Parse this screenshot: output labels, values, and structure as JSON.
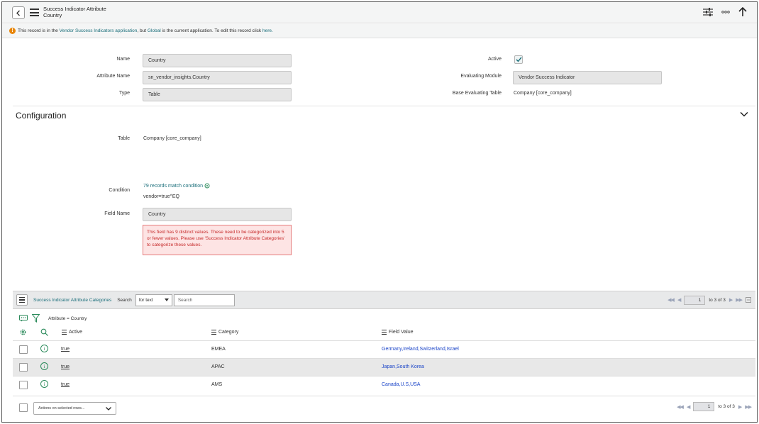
{
  "header": {
    "title": "Success Indicator Attribute",
    "subtitle": "Country"
  },
  "banner": {
    "prefix": "This record is in the",
    "app_link": "Vendor Success Indicators application",
    "middle": ", but",
    "global_link": "Global",
    "suffix": "is the current application. To edit this record click",
    "here_link": "here."
  },
  "form": {
    "name_label": "Name",
    "name_value": "Country",
    "attribute_name_label": "Attribute Name",
    "attribute_name_value": "sn_vendor_insights.Country",
    "type_label": "Type",
    "type_value": "Table",
    "active_label": "Active",
    "active_checked": true,
    "evaluating_module_label": "Evaluating Module",
    "evaluating_module_value": "Vendor Success Indicator",
    "base_table_label": "Base Evaluating Table",
    "base_table_value": "Company [core_company]"
  },
  "configuration": {
    "title": "Configuration",
    "table_label": "Table",
    "table_value": "Company [core_company]",
    "condition_label": "Condition",
    "condition_link": "79 records match condition",
    "condition_value": "vendor=true^EQ",
    "field_name_label": "Field Name",
    "field_name_value": "Country",
    "error_message": "This field has 9 distinct values. These need to be categorized into 5 or fewer values. Please use 'Success Indicator Attribute Categories' to categorize these values."
  },
  "related_list": {
    "title": "Success Indicator Attribute Categories",
    "search_label": "Search",
    "search_field": "for text",
    "search_placeholder": "Search",
    "page": "1",
    "page_range": "to 3 of 3",
    "filter_text": "Attribute = Country",
    "columns": {
      "active": "Active",
      "category": "Category",
      "field_value": "Field Value"
    },
    "rows": [
      {
        "active": "true",
        "category": "EMEA",
        "field_value": "Germany,Ireland,Switzerland,Israel"
      },
      {
        "active": "true",
        "category": "APAC",
        "field_value": "Japan,South Korea"
      },
      {
        "active": "true",
        "category": "AMS",
        "field_value": "Canada,U.S,USA"
      }
    ],
    "actions_placeholder": "Actions on selected rows...",
    "footer_page": "1",
    "footer_range": "to 3 of 3"
  },
  "colors": {
    "link": "#1a6e7a",
    "field_value_link": "#1a44c8",
    "error_text": "#c62a2a",
    "warning": "#e8860a"
  }
}
